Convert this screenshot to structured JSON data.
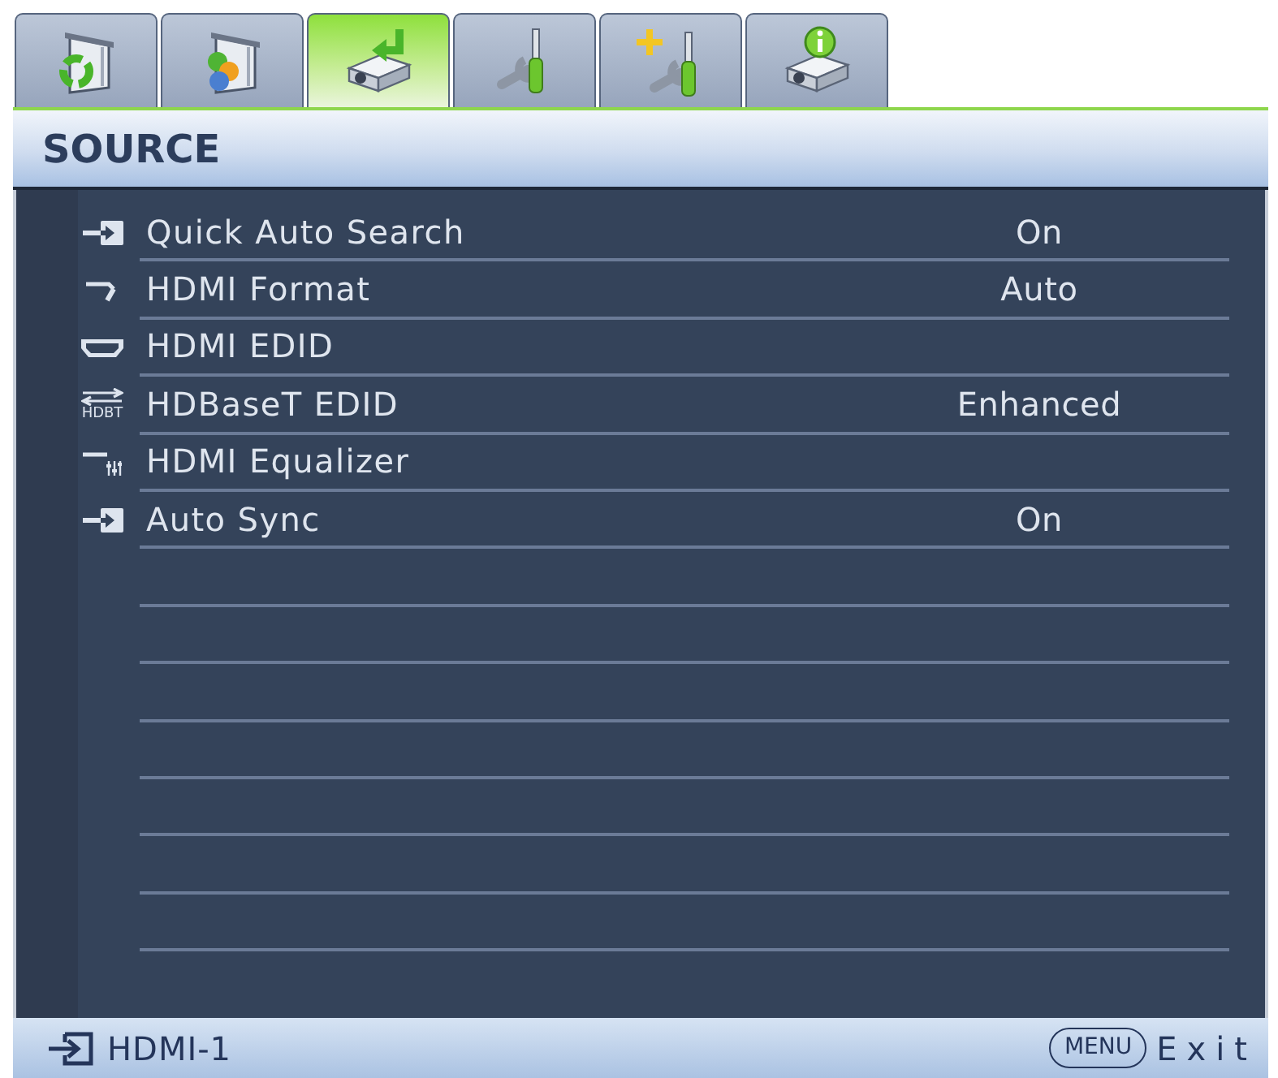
{
  "tabs": [
    {
      "selected": false
    },
    {
      "selected": false
    },
    {
      "selected": true
    },
    {
      "selected": false
    },
    {
      "selected": false
    },
    {
      "selected": false
    }
  ],
  "header": {
    "title": "SOURCE"
  },
  "rows": [
    {
      "label": "Quick Auto Search",
      "value": "On"
    },
    {
      "label": "HDMI Format",
      "value": "Auto"
    },
    {
      "label": "HDMI EDID"
    },
    {
      "label": "HDBaseT EDID",
      "value": "Enhanced",
      "icon_caption": "HDBT"
    },
    {
      "label": "HDMI Equalizer"
    },
    {
      "label": "Auto Sync",
      "value": "On"
    }
  ],
  "footer": {
    "source": "HDMI-1",
    "menu_key": "MENU",
    "exit_label": "Exit"
  }
}
